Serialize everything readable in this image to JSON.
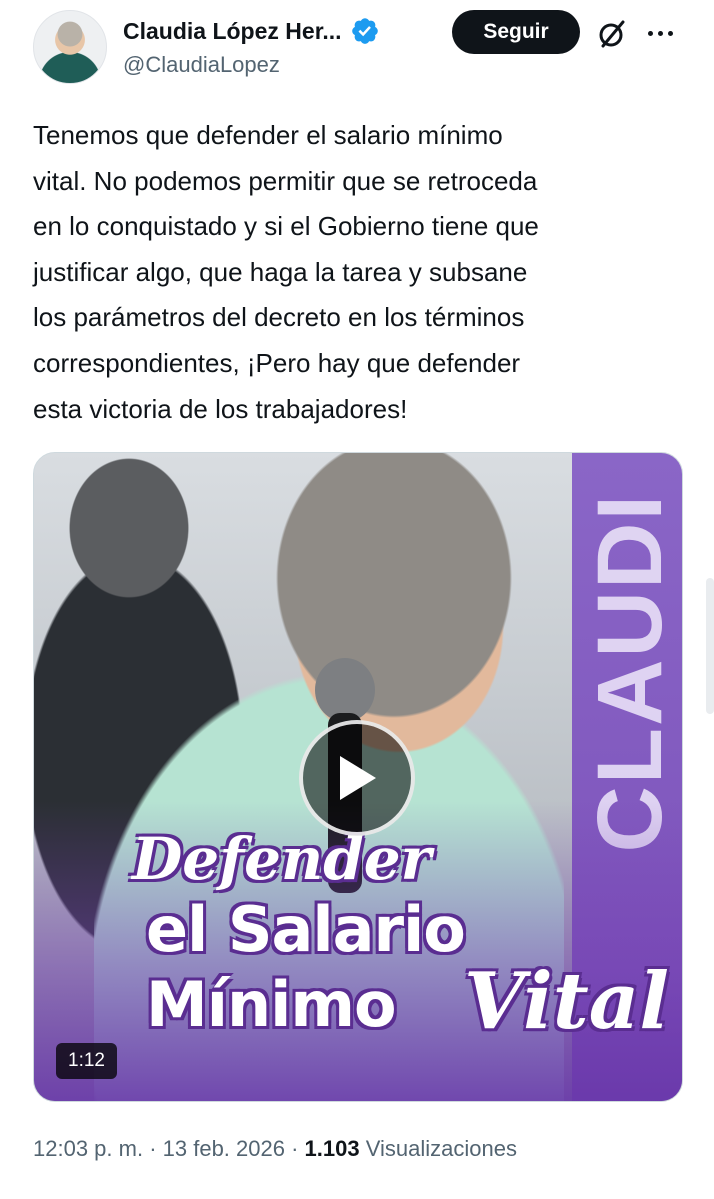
{
  "author": {
    "display_name": "Claudia López Her...",
    "handle": "@ClaudiaLopez",
    "follow_label": "Seguir"
  },
  "tweet": {
    "text": "Tenemos que defender el salario mínimo\nvital. No podemos permitir que se retroceda\nen lo conquistado y si el Gobierno tiene que\njustificar algo, que haga la tarea y subsane\nlos parámetros del decreto en los términos\ncorrespondientes, ¡Pero hay que defender\nesta victoria de los trabajadores!"
  },
  "media": {
    "overlay_line1": "Defender",
    "overlay_line2": "el Salario",
    "overlay_line3a": "Mínimo",
    "overlay_line3b": "Vital",
    "banner_text": "CLAUDI",
    "duration": "1:12"
  },
  "meta": {
    "time": "12:03 p. m.",
    "separator1": " · ",
    "date": "13 feb. 2026",
    "separator2": " · ",
    "views_count": "1.103",
    "views_label": " Visualizaciones"
  },
  "colors": {
    "verified": "#1d9bf0",
    "follow_bg": "#0f1419",
    "secondary_text": "#536471",
    "overlay_purple": "#5a2d91"
  },
  "icons": [
    "verified-badge-icon",
    "grok-icon",
    "more-icon",
    "play-icon"
  ]
}
